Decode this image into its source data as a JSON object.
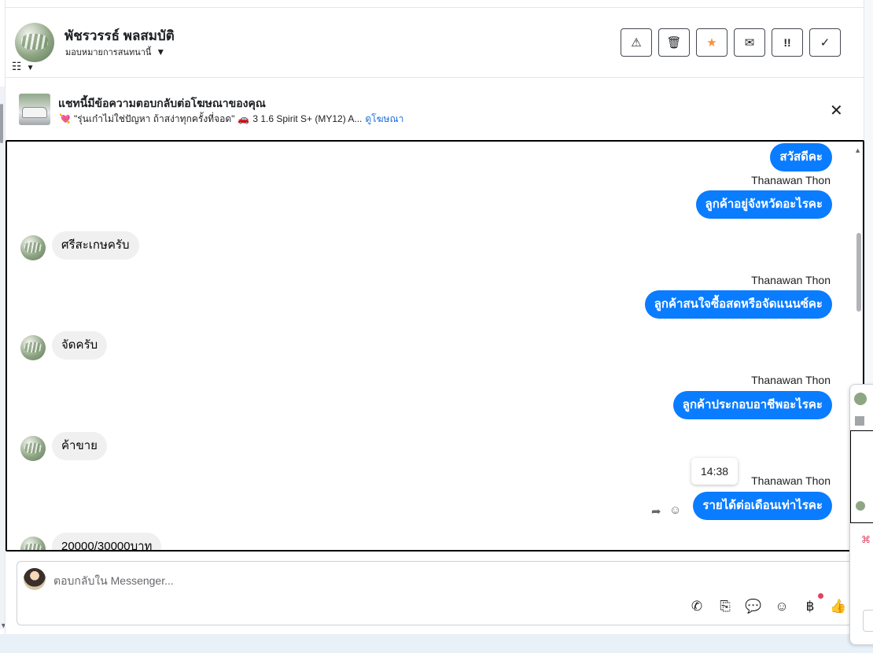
{
  "header": {
    "contact_name": "พัชรวรรธ์ พลสมบัติ",
    "assign_label": "มอบหมายการสนทนานี้",
    "actions": [
      {
        "name": "spam-button",
        "icon": "warning-icon",
        "glyph": "⚠"
      },
      {
        "name": "delete-button",
        "icon": "trash-icon",
        "glyph": "🗑"
      },
      {
        "name": "star-button",
        "icon": "star-icon",
        "glyph": "★"
      },
      {
        "name": "mark-unread-button",
        "icon": "envelope-icon",
        "glyph": "✉"
      },
      {
        "name": "follow-up-button",
        "icon": "important-icon",
        "glyph": "!!"
      },
      {
        "name": "done-button",
        "icon": "check-icon",
        "glyph": "✓"
      }
    ]
  },
  "ad_banner": {
    "title": "แชทนี้มีข้อความตอบกลับต่อโฆษณาของคุณ",
    "description": "\"รุ่นเก๋าไม่ใช่ปัญหา ถ้าสง่าทุกครั้งที่จอด\"",
    "car_text": "3 1.6 Spirit S+ (MY12) A...",
    "link_label": "ดูโฆษณา"
  },
  "messages": [
    {
      "direction": "out",
      "text": "สวัสดีคะ"
    },
    {
      "direction": "out",
      "sender": "Thanawan Thon",
      "text": "ลูกค้าอยู่จังหวัดอะไรคะ"
    },
    {
      "direction": "in",
      "text": "ศรีสะเกษครับ"
    },
    {
      "direction": "out",
      "sender": "Thanawan Thon",
      "text": "ลูกค้าสนใจซื้อสดหรือจัดแนนซ์คะ"
    },
    {
      "direction": "in",
      "text": "จัดครับ"
    },
    {
      "direction": "out",
      "sender": "Thanawan Thon",
      "text": "ลูกค้าประกอบอาชีพอะไรคะ"
    },
    {
      "direction": "in",
      "text": "ค้าขาย"
    },
    {
      "direction": "out",
      "sender": "Thanawan Thon",
      "text": "รายได้ต่อเดือนเท่าไรคะ",
      "tooltip": "14:38"
    },
    {
      "direction": "in",
      "text": "20000/30000บาท"
    }
  ],
  "composer": {
    "placeholder": "ตอบกลับใน Messenger..."
  },
  "colors": {
    "outgoing_bubble": "#0a7cff",
    "incoming_bubble": "#f0f0f0",
    "star": "#f7923a",
    "link": "#1a6dd6"
  }
}
